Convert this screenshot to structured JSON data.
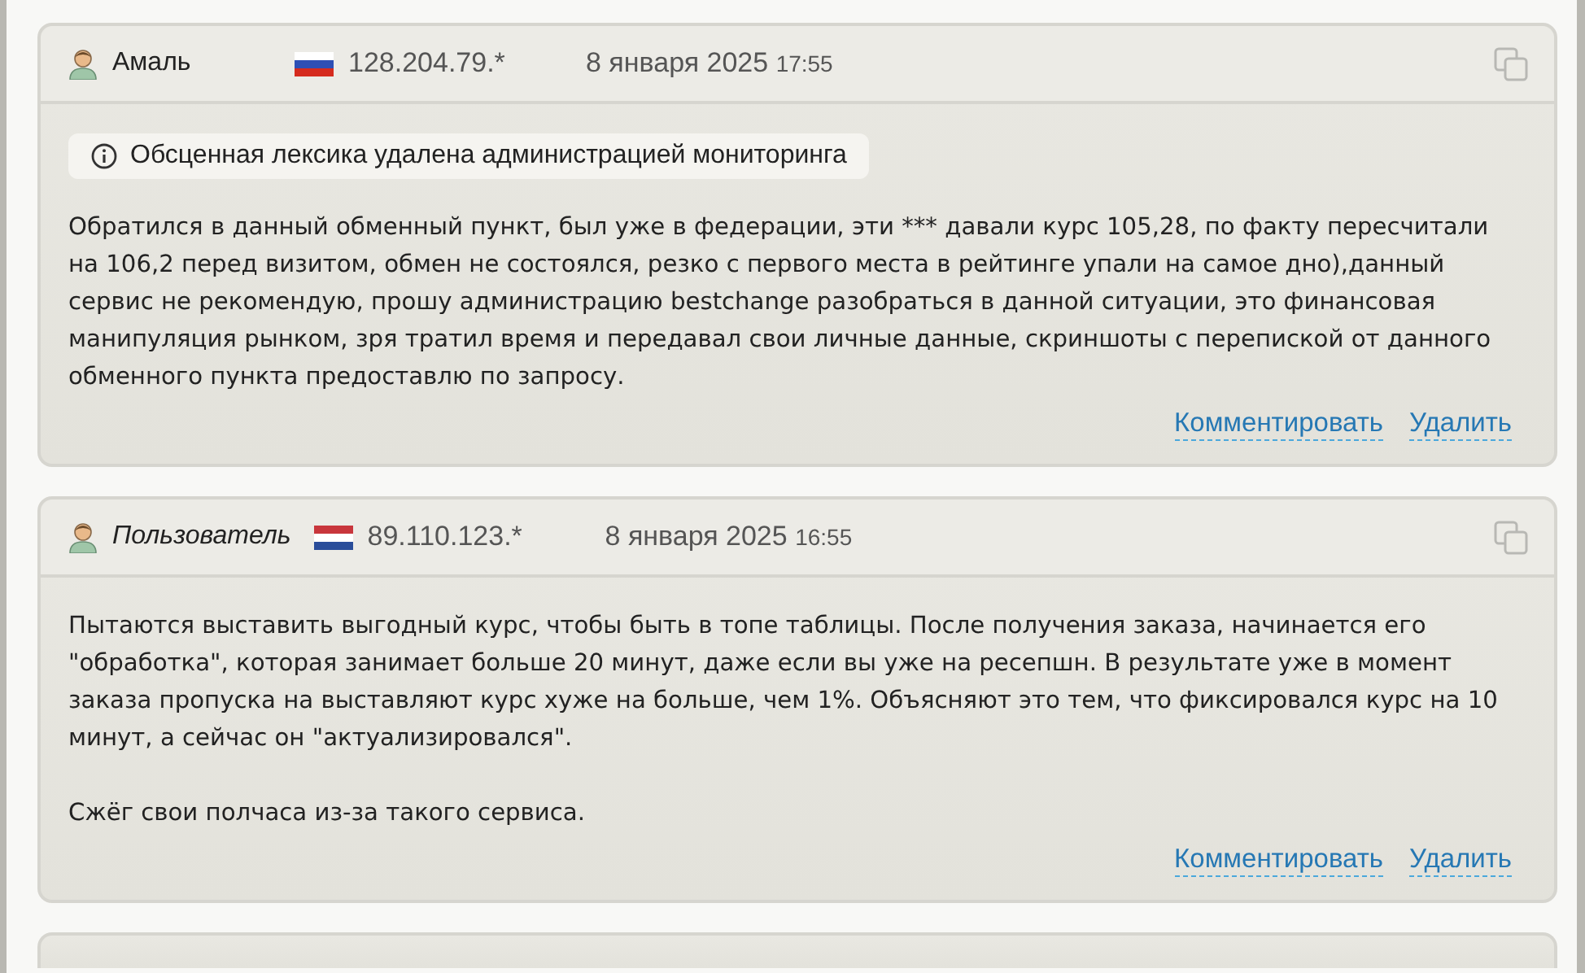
{
  "reviews": [
    {
      "author": "Амаль",
      "anonymous": false,
      "flag": {
        "kind": "ru"
      },
      "ip": "128.204.79.*",
      "date": "8 января 2025",
      "time": "17:55",
      "notice": "Обсценная лексика удалена администрацией мониторинга",
      "paragraphs": [
        "Обратился в данный обменный пункт, был уже в федерации, эти *** давали курс 105,28, по факту пересчитали на 106,2 перед визитом, обмен не состоялся, резко с первого места в рейтинге упали на самое дно),данный сервис не рекомендую, прошу администрацию bestchange разобраться в данной ситуации, это финансовая манипуляция рынком, зря тратил время и передавал свои личные данные, скриншоты с перепиской от данного обменного пункта предоставлю по запросу."
      ],
      "actions": [
        "Комментировать",
        "Удалить"
      ]
    },
    {
      "author": "Пользователь",
      "anonymous": true,
      "flag": {
        "kind": "nl"
      },
      "ip": "89.110.123.*",
      "date": "8 января 2025",
      "time": "16:55",
      "paragraphs": [
        "Пытаются выставить выгодный курс, чтобы быть в топе таблицы. После получения заказа, начинается его \"обработка\", которая занимает больше 20 минут, даже если вы уже на ресепшн. В результате уже в момент заказа пропуска на выставляют курс хуже на больше, чем 1%. Объясняют это тем, что фиксировался курс на 10 минут, а сейчас он \"актуализировался\".",
        "Сжёг свои полчаса из-за такого сервиса."
      ],
      "actions": [
        "Комментировать",
        "Удалить"
      ]
    }
  ]
}
